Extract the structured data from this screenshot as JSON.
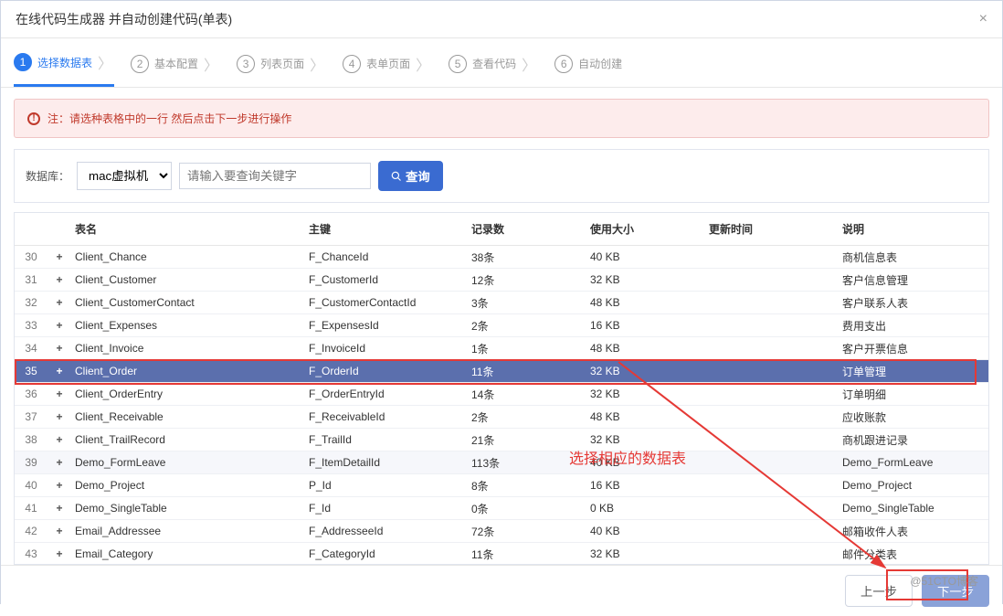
{
  "modal": {
    "title": "在线代码生成器 并自动创建代码(单表)",
    "close": "×"
  },
  "steps": [
    {
      "num": "1",
      "label": "选择数据表",
      "active": true
    },
    {
      "num": "2",
      "label": "基本配置"
    },
    {
      "num": "3",
      "label": "列表页面"
    },
    {
      "num": "4",
      "表单页面": "",
      "label": "表单页面"
    },
    {
      "num": "5",
      "label": "查看代码"
    },
    {
      "num": "6",
      "label": "自动创建"
    }
  ],
  "alert": {
    "icon": "!",
    "text": "注：请选种表格中的一行 然后点击下一步进行操作"
  },
  "query": {
    "db_label": "数据库：",
    "db_value": "mac虚拟机",
    "search_placeholder": "请输入要查询关键字",
    "search_btn": "查询"
  },
  "columns": {
    "name": "表名",
    "key": "主键",
    "count": "记录数",
    "size": "使用大小",
    "updated": "更新时间",
    "desc": "说明"
  },
  "rows": [
    {
      "idx": "30",
      "name": "Client_Chance",
      "key": "F_ChanceId",
      "count": "38条",
      "size": "40 KB",
      "updated": "",
      "desc": "商机信息表",
      "selected": false
    },
    {
      "idx": "31",
      "name": "Client_Customer",
      "key": "F_CustomerId",
      "count": "12条",
      "size": "32 KB",
      "updated": "",
      "desc": "客户信息管理",
      "selected": false
    },
    {
      "idx": "32",
      "name": "Client_CustomerContact",
      "key": "F_CustomerContactId",
      "count": "3条",
      "size": "48 KB",
      "updated": "",
      "desc": "客户联系人表",
      "selected": false
    },
    {
      "idx": "33",
      "name": "Client_Expenses",
      "key": "F_ExpensesId",
      "count": "2条",
      "size": "16 KB",
      "updated": "",
      "desc": "费用支出",
      "selected": false
    },
    {
      "idx": "34",
      "name": "Client_Invoice",
      "key": "F_InvoiceId",
      "count": "1条",
      "size": "48 KB",
      "updated": "",
      "desc": "客户开票信息",
      "selected": false
    },
    {
      "idx": "35",
      "name": "Client_Order",
      "key": "F_OrderId",
      "count": "11条",
      "size": "32 KB",
      "updated": "",
      "desc": "订单管理",
      "selected": true
    },
    {
      "idx": "36",
      "name": "Client_OrderEntry",
      "key": "F_OrderEntryId",
      "count": "14条",
      "size": "32 KB",
      "updated": "",
      "desc": "订单明细",
      "selected": false
    },
    {
      "idx": "37",
      "name": "Client_Receivable",
      "key": "F_ReceivableId",
      "count": "2条",
      "size": "48 KB",
      "updated": "",
      "desc": "应收账款",
      "selected": false
    },
    {
      "idx": "38",
      "name": "Client_TrailRecord",
      "key": "F_TrailId",
      "count": "21条",
      "size": "32 KB",
      "updated": "",
      "desc": "商机跟进记录",
      "selected": false
    },
    {
      "idx": "39",
      "name": "Demo_FormLeave",
      "key": "F_ItemDetailId",
      "count": "113条",
      "size": "40 KB",
      "updated": "",
      "desc": "Demo_FormLeave",
      "selected": false,
      "striped": true
    },
    {
      "idx": "40",
      "name": "Demo_Project",
      "key": "P_Id",
      "count": "8条",
      "size": "16 KB",
      "updated": "",
      "desc": "Demo_Project",
      "selected": false
    },
    {
      "idx": "41",
      "name": "Demo_SingleTable",
      "key": "F_Id",
      "count": "0条",
      "size": "0 KB",
      "updated": "",
      "desc": "Demo_SingleTable",
      "selected": false
    },
    {
      "idx": "42",
      "name": "Email_Addressee",
      "key": "F_AddresseeId",
      "count": "72条",
      "size": "40 KB",
      "updated": "",
      "desc": "邮箱收件人表",
      "selected": false
    },
    {
      "idx": "43",
      "name": "Email_Category",
      "key": "F_CategoryId",
      "count": "11条",
      "size": "32 KB",
      "updated": "",
      "desc": "邮件分类表",
      "selected": false
    }
  ],
  "annotation": "选择相应的数据表",
  "footer": {
    "prev": "上一步",
    "next": "下一步"
  },
  "watermark": "@51CTO博客",
  "colors": {
    "primary": "#3a6bd1",
    "selected_row": "#5b6fad",
    "annotation": "#e53935",
    "alert_bg": "#fdecec",
    "alert_text": "#c0392b"
  }
}
